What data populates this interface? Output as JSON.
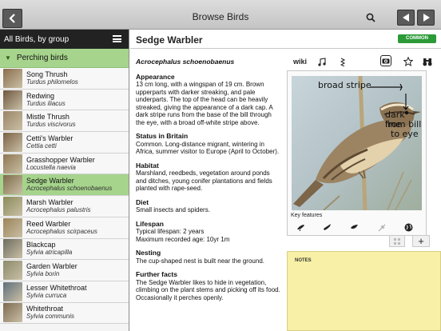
{
  "topbar": {
    "title": "Browse Birds",
    "back_icon": "chevron-left-icon",
    "search_icon": "search-icon",
    "prev_icon": "triangle-left-icon",
    "next_icon": "triangle-right-icon"
  },
  "sidebar": {
    "header": "All Birds, by group",
    "menu_icon": "hamburger-menu-icon",
    "group": "Perching birds",
    "birds": [
      {
        "name": "Song Thrush",
        "sci": "Turdus philomelos",
        "color": "#8a6d4d"
      },
      {
        "name": "Redwing",
        "sci": "Turdus iliacus",
        "color": "#6e5740"
      },
      {
        "name": "Mistle Thrush",
        "sci": "Turdus viscivorus",
        "color": "#9a8566"
      },
      {
        "name": "Cetti's Warbler",
        "sci": "Cettia cetti",
        "color": "#7b6244"
      },
      {
        "name": "Grasshopper Warbler",
        "sci": "Locustella naevia",
        "color": "#8d7652"
      },
      {
        "name": "Sedge Warbler",
        "sci": "Acrocephalus schoenobaenus",
        "color": "#7f6c4a",
        "selected": true
      },
      {
        "name": "Marsh Warbler",
        "sci": "Acrocephalus palustris",
        "color": "#8a8b5a"
      },
      {
        "name": "Reed Warbler",
        "sci": "Acrocephalus scirpaceus",
        "color": "#9a8358"
      },
      {
        "name": "Blackcap",
        "sci": "Sylvia atricapilla",
        "color": "#6c6c5e"
      },
      {
        "name": "Garden Warbler",
        "sci": "Sylvia borin",
        "color": "#8b8a6a"
      },
      {
        "name": "Lesser Whitethroat",
        "sci": "Sylvia curruca",
        "color": "#5f6f7a"
      },
      {
        "name": "Whitethroat",
        "sci": "Sylvia communis",
        "color": "#7d6a50"
      }
    ]
  },
  "main": {
    "title": "Sedge Warbler",
    "badge": "COMMON",
    "badge_color": "#2b9a37",
    "sci_name": "Acrocephalus schoenobaenus",
    "sections": {
      "appearance": {
        "title": "Appearance",
        "text": "13 cm long, with a wingspan of 19 cm. Brown upperparts with darker streaking, and pale underparts. The top of the head can be heavily streaked, giving the appearance of a dark cap. A dark stripe runs from the base of the bill through the eye, with a broad off-white stripe above."
      },
      "status": {
        "title": "Status in Britain",
        "text": "Common. Long-distance migrant, wintering in Africa, summer visitor to Europe (April to October)."
      },
      "habitat": {
        "title": "Habitat",
        "text": "Marshland, reedbeds, vegetation around ponds and ditches, young conifer plantations and fields planted with rape-seed."
      },
      "diet": {
        "title": "Diet",
        "text": "Small insects and spiders."
      },
      "lifespan": {
        "title": "Lifespan",
        "line1": "Typical lifespan: 2 years",
        "line2": "Maximum recorded age: 10yr 1m"
      },
      "nesting": {
        "title": "Nesting",
        "text": "The cup-shaped nest is built near the ground."
      },
      "facts": {
        "title": "Further facts",
        "text": "The Sedge Warbler likes to hide in vegetation, climbing on the plant stems and picking off its food. Occasionally it perches openly."
      }
    },
    "tabs": {
      "wiki": "wiki",
      "music_icon": "music-note-icon",
      "sonogram_icon": "sonogram-icon",
      "camera_icon": "camera-icon",
      "star_icon": "star-icon",
      "binoculars_icon": "binoculars-icon"
    },
    "photo": {
      "annotation_stripe": "broad stripe",
      "annotation_line1": "dark line",
      "annotation_line2": "from bill",
      "annotation_line3": "to eye"
    },
    "key_features_label": "Key features",
    "key_feature_icons": [
      "bird-perched-icon",
      "bird-flying-icon",
      "bird-small-icon",
      "feather-icon",
      "globe-icon"
    ],
    "grid_icon": "grid-icon",
    "add_label": "+",
    "notes_label": "NOTES"
  }
}
